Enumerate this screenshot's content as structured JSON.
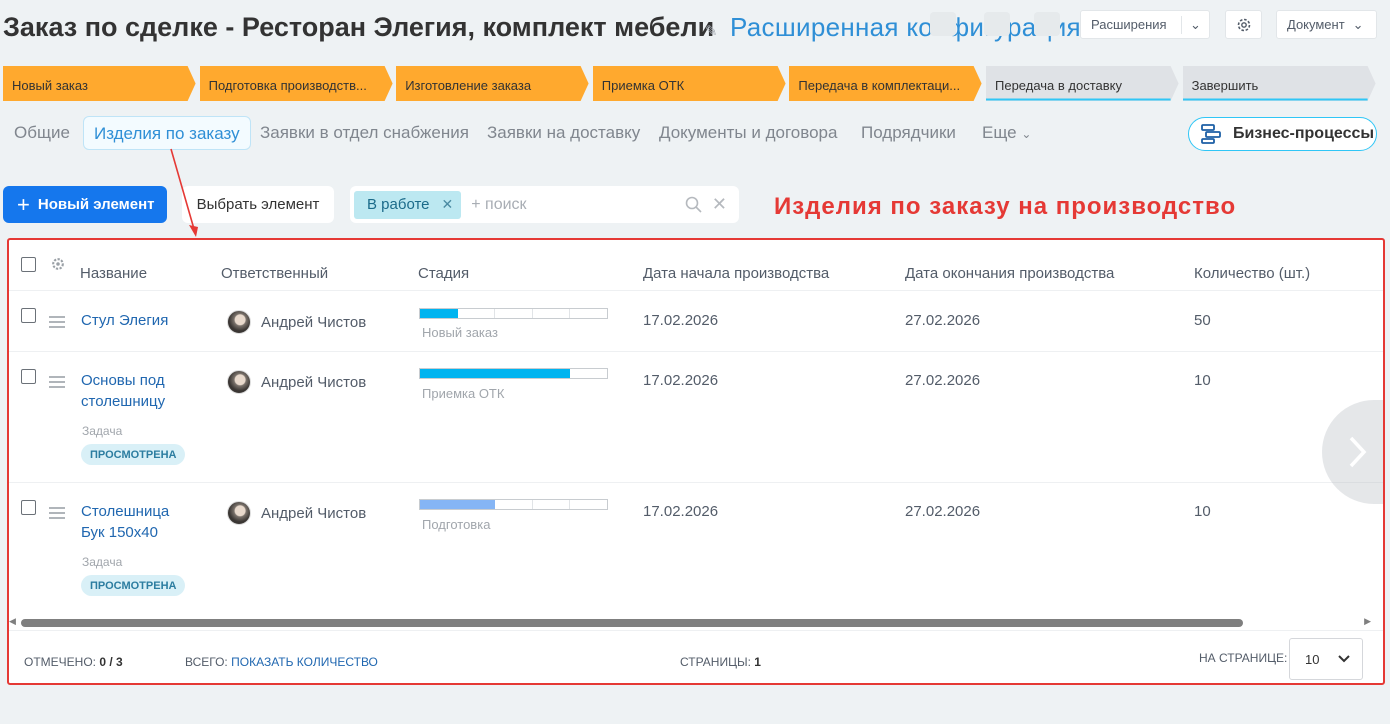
{
  "header": {
    "title": "Заказ по сделке - Ресторан Элегия, комплект мебели",
    "config_link": "Расширенная конфигурация",
    "extensions_label": "Расширения",
    "document_label": "Документ"
  },
  "stages": [
    {
      "label": "Новый заказ",
      "color": "#ffa92e",
      "done": true
    },
    {
      "label": "Подготовка производств...",
      "color": "#ffa92e",
      "done": true
    },
    {
      "label": "Изготовление заказа",
      "color": "#ffa92e",
      "done": true
    },
    {
      "label": "Приемка ОТК",
      "color": "#ffa92e",
      "done": true
    },
    {
      "label": "Передача в комплектаци...",
      "color": "#ffa92e",
      "done": true
    },
    {
      "label": "Передача в доставку",
      "color": "#dfe2e6",
      "done": false
    },
    {
      "label": "Завершить",
      "color": "#dfe2e6",
      "done": false
    }
  ],
  "tabs": [
    "Общие",
    "Изделия по заказу",
    "Заявки в отдел снабжения",
    "Заявки на доставку",
    "Документы и договора",
    "Подрядчики",
    "Еще"
  ],
  "active_tab": "Изделия по заказу",
  "business_processes_label": "Бизнес-процессы",
  "toolbar": {
    "new_element": "Новый элемент",
    "pick_element": "Выбрать элемент",
    "filter_chip": "В работе",
    "search_placeholder": "+ поиск"
  },
  "annotation": "Изделия по заказу на производство",
  "table": {
    "columns": [
      "Название",
      "Ответственный",
      "Стадия",
      "Дата начала производства",
      "Дата окончания производства",
      "Количество (шт.)"
    ],
    "rows": [
      {
        "name": "Стул Элегия",
        "responsible": "Андрей Чистов",
        "stage": "Новый заказ",
        "progress_segments": 1,
        "stage_color": "#00b4f0",
        "start": "17.02.2026",
        "end": "27.02.2026",
        "qty": "50",
        "task_caption": "",
        "badge": ""
      },
      {
        "name": "Основы под столешницу",
        "responsible": "Андрей Чистов",
        "stage": "Приемка ОТК",
        "progress_segments": 4,
        "stage_color": "#00b4f0",
        "start": "17.02.2026",
        "end": "27.02.2026",
        "qty": "10",
        "task_caption": "Задача",
        "badge": "ПРОСМОТРЕНА"
      },
      {
        "name": "Столешница Бук 150х40",
        "responsible": "Андрей Чистов",
        "stage": "Подготовка",
        "progress_segments": 2,
        "stage_color": "#85b5f5",
        "start": "17.02.2026",
        "end": "27.02.2026",
        "qty": "10",
        "task_caption": "Задача",
        "badge": "ПРОСМОТРЕНА"
      }
    ]
  },
  "footer": {
    "selected_label": "ОТМЕЧЕНО:",
    "selected_value": "0 / 3",
    "total_label": "ВСЕГО:",
    "total_link": "ПОКАЗАТЬ КОЛИЧЕСТВО",
    "pages_label": "СТРАНИЦЫ:",
    "pages_value": "1",
    "per_page_label": "НА СТРАНИЦЕ:",
    "per_page_value": "10"
  }
}
